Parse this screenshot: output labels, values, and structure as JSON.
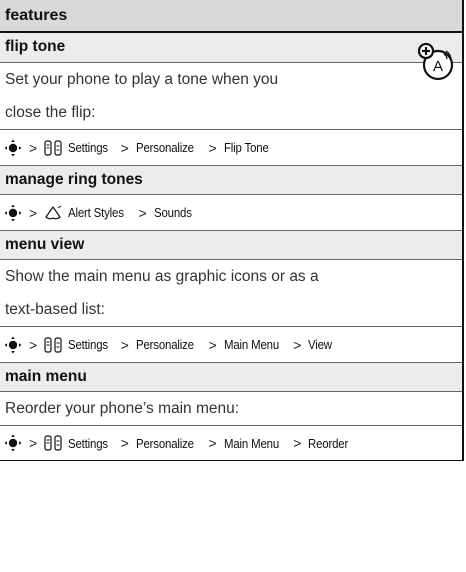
{
  "header": {
    "title": "features"
  },
  "sections": [
    {
      "title": "flip tone",
      "text_lines": [
        "Set your phone to play a tone when you",
        "close the flip:"
      ],
      "path": {
        "icon": "settings-icon",
        "items": [
          "Settings",
          "Personalize",
          "Flip Tone"
        ]
      }
    },
    {
      "title": "manage ring tones",
      "text_lines": [],
      "path": {
        "icon": "alert-styles-icon",
        "items": [
          "Alert Styles",
          "Sounds"
        ]
      }
    },
    {
      "title": "menu view",
      "text_lines": [
        "Show the main menu as graphic icons or as a",
        "text-based list:"
      ],
      "path": {
        "icon": "settings-icon",
        "items": [
          "Settings",
          "Personalize",
          "Main Menu",
          "View"
        ]
      }
    },
    {
      "title": "main menu",
      "text_lines": [
        "Reorder your phone’s main menu:"
      ],
      "path": {
        "icon": "settings-icon",
        "items": [
          "Settings",
          "Personalize",
          "Main Menu",
          "Reorder"
        ]
      }
    }
  ],
  "separator": ">",
  "icons": {
    "nav": "navigation-key-icon",
    "accessory": "optional-accessory-icon"
  }
}
